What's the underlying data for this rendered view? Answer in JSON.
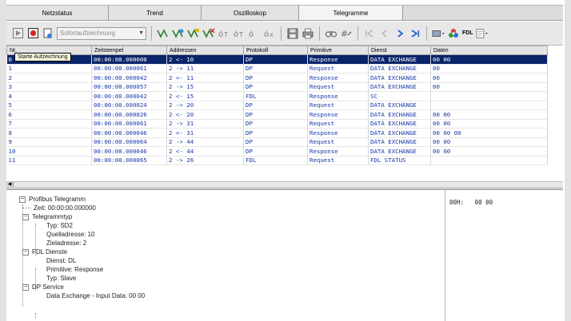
{
  "tabs": [
    "Netzstatus",
    "Trend",
    "Oszilloskop",
    "Telegramme"
  ],
  "active_tab": 3,
  "toolbar": {
    "recording_mode": "Sofortaufzeichnung",
    "fdl_label": "FDL",
    "tooltip": "Starte Aufzeichnung"
  },
  "table": {
    "columns": [
      "Nr.",
      "Zeitstempel",
      "Addressen",
      "Protokoll",
      "Primitive",
      "Dienst",
      "Daten"
    ],
    "selected_row": 0,
    "rows": [
      [
        "0",
        "00:00:00.000000",
        "2 <- 10",
        "DP",
        "Response",
        "DATA EXCHANGE",
        "00 00"
      ],
      [
        "1",
        "00:00:00.000061",
        "2 -> 11",
        "DP",
        "Request",
        "DATA EXCHANGE",
        "00"
      ],
      [
        "2",
        "00:00:00.000042",
        "2 <- 11",
        "DP",
        "Response",
        "DATA EXCHANGE",
        "00"
      ],
      [
        "3",
        "00:00:00.000057",
        "2 -> 15",
        "DP",
        "Request",
        "DATA EXCHANGE",
        "00"
      ],
      [
        "4",
        "00:00:00.000042",
        "2 <- 15",
        "FDL",
        "Response",
        "SC",
        ""
      ],
      [
        "5",
        "00:00:00.000024",
        "2 -> 20",
        "DP",
        "Request",
        "DATA EXCHANGE",
        ""
      ],
      [
        "6",
        "00:00:00.000026",
        "2 <- 20",
        "DP",
        "Response",
        "DATA EXCHANGE",
        "00 00"
      ],
      [
        "7",
        "00:00:00.000061",
        "2 -> 31",
        "DP",
        "Request",
        "DATA EXCHANGE",
        "00 00"
      ],
      [
        "8",
        "00:00:00.000046",
        "2 <- 31",
        "DP",
        "Response",
        "DATA EXCHANGE",
        "00 00 00"
      ],
      [
        "9",
        "00:00:00.000064",
        "2 -> 44",
        "DP",
        "Request",
        "DATA EXCHANGE",
        "00 00"
      ],
      [
        "10",
        "00:00:00.000046",
        "2 <- 44",
        "DP",
        "Response",
        "DATA EXCHANGE",
        "00 00"
      ],
      [
        "11",
        "00:00:00.000065",
        "2 -> 26",
        "FDL",
        "Request",
        "FDL STATUS",
        ""
      ]
    ]
  },
  "tree": {
    "root": "Profibus Telegramm",
    "zeit": "Zeit: 00:00:00.000000",
    "telegrammtyp": "Telegrammtyp",
    "typ": "Typ: SD2",
    "quelladresse": "Quelladresse: 10",
    "zieladresse": "Zieladresse: 2",
    "fdl_dienste": "FDL Dienste",
    "dienst": "Dienst: DL",
    "primitive": "Primitive: Response",
    "typ_slave": "Typ: Slave",
    "dp_service": "DP Service",
    "data_exchange": "Data Exchange - Input Data: 00 00"
  },
  "hex_view": "00H:   00 00"
}
